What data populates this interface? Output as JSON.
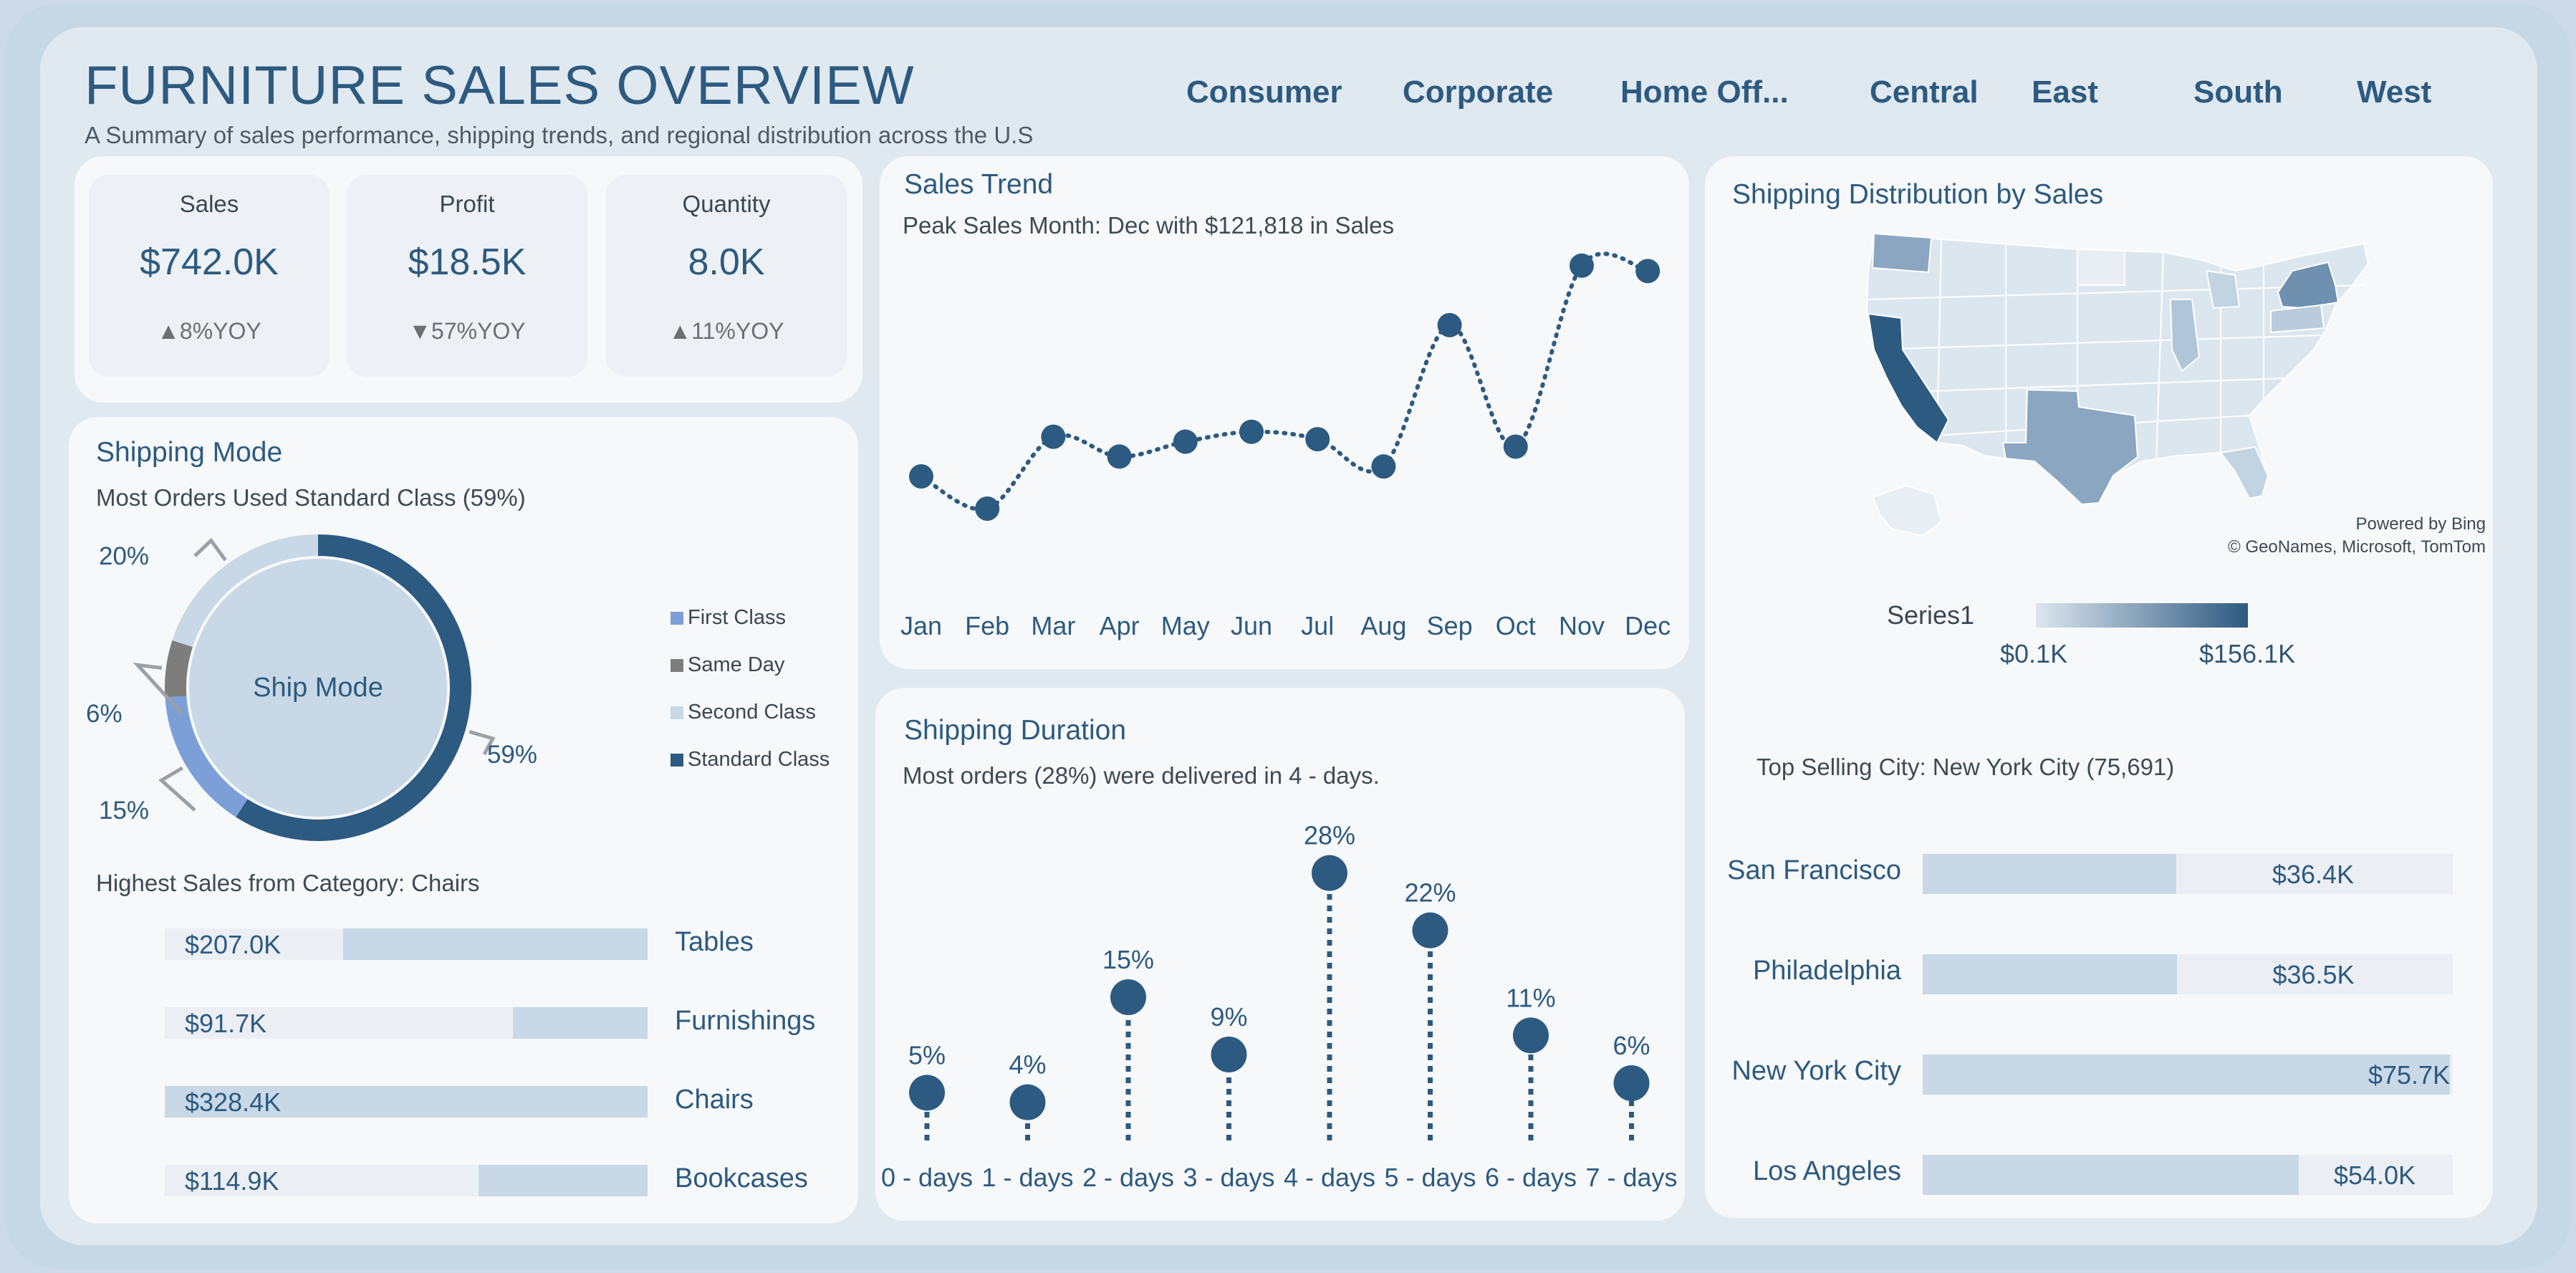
{
  "header": {
    "title": "FURNITURE SALES OVERVIEW",
    "subtitle": "A Summary of sales performance, shipping trends, and regional distribution across the U.S"
  },
  "filters": {
    "segments": [
      "Consumer",
      "Corporate",
      "Home Off..."
    ],
    "regions": [
      "Central",
      "East",
      "South",
      "West"
    ]
  },
  "kpis": [
    {
      "label": "Sales",
      "value": "$742.0K",
      "yoy": "▲8%YOY"
    },
    {
      "label": "Profit",
      "value": "$18.5K",
      "yoy": "▼57%YOY"
    },
    {
      "label": "Quantity",
      "value": "8.0K",
      "yoy": "▲11%YOY"
    }
  ],
  "shipping_mode": {
    "title": "Shipping Mode",
    "note": "Most Orders Used Standard Class (59%)",
    "center_label": "Ship Mode",
    "legend": [
      "First Class",
      "Same Day",
      "Second Class",
      "Standard Class"
    ]
  },
  "category": {
    "note": "Highest Sales from Category: Chairs"
  },
  "sales_trend": {
    "title": "Sales Trend",
    "note": "Peak Sales Month: Dec with $121,818 in Sales"
  },
  "shipping_duration": {
    "title": "Shipping Duration",
    "note": "Most orders (28%) were delivered in 4 - days."
  },
  "map": {
    "title": "Shipping Distribution by Sales",
    "credit_1": "Powered by Bing",
    "credit_2": "© GeoNames, Microsoft, TomTom",
    "legend_title": "Series1",
    "legend_min": "$0.1K",
    "legend_max": "$156.1K",
    "color_low": "#dce6ef",
    "color_high": "#2d5a80"
  },
  "top_city": {
    "note": "Top Selling City: New York City (75,691)"
  },
  "chart_data": [
    {
      "id": "ship-mode",
      "type": "pie",
      "title": "Shipping Mode",
      "slices": [
        {
          "name": "Standard Class",
          "value": 59,
          "label": "59%",
          "color": "#2d5a80"
        },
        {
          "name": "First Class",
          "value": 15,
          "label": "15%",
          "color": "#7c9fd8"
        },
        {
          "name": "Same Day",
          "value": 6,
          "label": "6%",
          "color": "#7d7d7d"
        },
        {
          "name": "Second Class",
          "value": 20,
          "label": "20%",
          "color": "#c8d8e6"
        }
      ]
    },
    {
      "id": "category-sales",
      "type": "bar",
      "categories": [
        "Tables",
        "Furnishings",
        "Chairs",
        "Bookcases"
      ],
      "values": [
        207.0,
        91.7,
        328.4,
        114.9
      ],
      "value_labels": [
        "$207.0K",
        "$91.7K",
        "$328.4K",
        "$114.9K"
      ],
      "unit": "$K",
      "xlim": [
        0,
        328.4
      ]
    },
    {
      "id": "sales-trend",
      "type": "line",
      "title": "Sales Trend",
      "categories": [
        "Jan",
        "Feb",
        "Mar",
        "Apr",
        "May",
        "Jun",
        "Jul",
        "Aug",
        "Sep",
        "Oct",
        "Nov",
        "Dec"
      ],
      "values": [
        39000,
        26000,
        55000,
        47000,
        53000,
        57000,
        54000,
        43000,
        100000,
        51000,
        124000,
        121818
      ],
      "ylim": [
        0,
        130000
      ]
    },
    {
      "id": "shipping-duration",
      "type": "scatter",
      "title": "Shipping Duration",
      "categories": [
        "0 - days",
        "1 - days",
        "2 - days",
        "3 - days",
        "4 - days",
        "5 - days",
        "6 - days",
        "7 - days"
      ],
      "values": [
        5,
        4,
        15,
        9,
        28,
        22,
        11,
        6
      ],
      "value_labels": [
        "5%",
        "4%",
        "15%",
        "9%",
        "28%",
        "22%",
        "11%",
        "6%"
      ],
      "ylim": [
        0,
        30
      ]
    },
    {
      "id": "top-cities",
      "type": "bar",
      "categories": [
        "San Francisco",
        "Philadelphia",
        "New York City",
        "Los Angeles"
      ],
      "values": [
        36.4,
        36.5,
        75.7,
        54.0
      ],
      "value_labels": [
        "$36.4K",
        "$36.5K",
        "$75.7K",
        "$54.0K"
      ],
      "unit": "$K",
      "xlim": [
        0,
        75.7
      ]
    }
  ]
}
